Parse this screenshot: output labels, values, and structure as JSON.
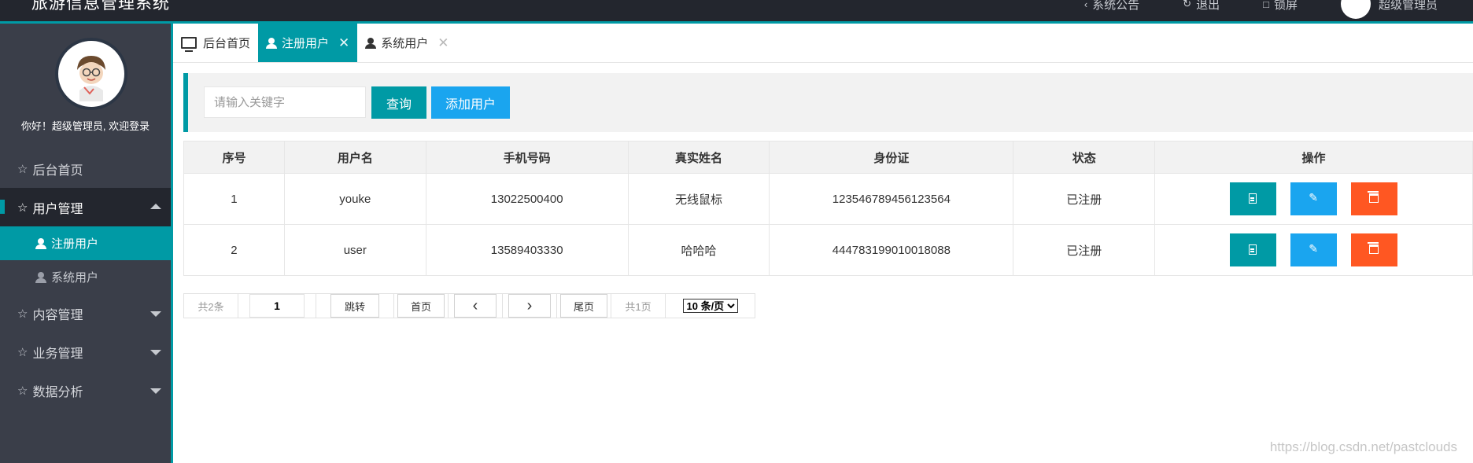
{
  "header": {
    "app_title": "旅游信息管理系统",
    "links": [
      {
        "icon": "prev-icon",
        "label": "系统公告"
      },
      {
        "icon": "refresh-icon",
        "label": "退出"
      },
      {
        "icon": "lock-icon",
        "label": "锁屏"
      }
    ],
    "user_label": "超级管理员"
  },
  "sidebar": {
    "greeting": "你好！超级管理员, 欢迎登录",
    "menu": [
      {
        "label": "后台首页",
        "icon": "star-icon",
        "has_caret": false
      },
      {
        "label": "用户管理",
        "icon": "star-icon",
        "expanded": true,
        "children": [
          {
            "label": "注册用户",
            "icon": "user-icon",
            "active": true
          },
          {
            "label": "系统用户",
            "icon": "user-icon",
            "active": false
          }
        ]
      },
      {
        "label": "内容管理",
        "icon": "star-icon",
        "has_caret": true
      },
      {
        "label": "业务管理",
        "icon": "star-icon",
        "has_caret": true
      },
      {
        "label": "数据分析",
        "icon": "star-icon",
        "has_caret": true
      }
    ]
  },
  "tabs": [
    {
      "label": "后台首页",
      "icon": "monitor-icon",
      "active": false,
      "closable": false
    },
    {
      "label": "注册用户",
      "icon": "user-icon",
      "active": true,
      "closable": true
    },
    {
      "label": "系统用户",
      "icon": "user-icon",
      "active": false,
      "closable": true
    }
  ],
  "search": {
    "placeholder": "请输入关键字",
    "value": "",
    "query_button": "查询",
    "add_button": "添加用户"
  },
  "table": {
    "columns": [
      "序号",
      "用户名",
      "手机号码",
      "真实姓名",
      "身份证",
      "状态",
      "操作"
    ],
    "rows": [
      [
        "1",
        "youke",
        "13022500400",
        "无线鼠标",
        "123546789456123564",
        "已注册"
      ],
      [
        "2",
        "user",
        "13589403330",
        "哈哈哈",
        "444783199010018088",
        "已注册"
      ]
    ],
    "actions": [
      "view-icon",
      "edit-icon",
      "delete-icon"
    ]
  },
  "pagination": {
    "total": "共2条",
    "page_input": "1",
    "jump": "跳转",
    "first": "首页",
    "last": "尾页",
    "pages": "共1页",
    "page_size": "10 条/页"
  },
  "watermark": "https://blog.csdn.net/pastclouds",
  "colors": {
    "accent": "#009aa5",
    "blue": "#1aa5ef",
    "danger": "#ff5722",
    "sidebar": "#3a3e49",
    "topbar": "#23262e"
  }
}
